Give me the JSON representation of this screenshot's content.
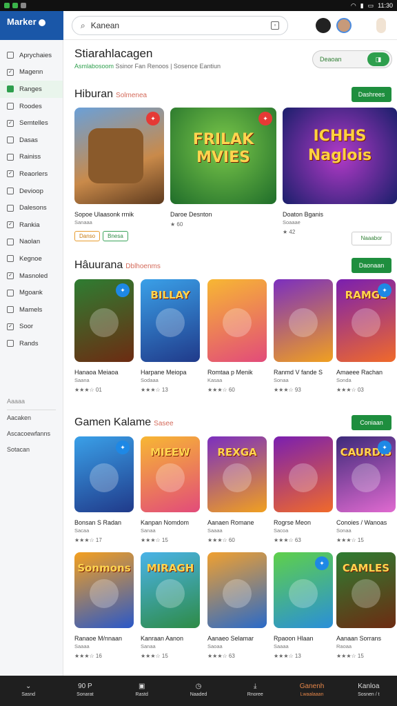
{
  "status": {
    "time": "11:30"
  },
  "app": {
    "logo": "Marker",
    "logo_sub": ""
  },
  "search": {
    "value": "Kanean"
  },
  "sidebar": {
    "items": [
      {
        "label": "Aprychaies"
      },
      {
        "label": "Magenn"
      },
      {
        "label": "Ranges",
        "active": true
      },
      {
        "label": "Roodes"
      },
      {
        "label": "Semtelles"
      },
      {
        "label": "Dasas"
      },
      {
        "label": "Rainiss"
      },
      {
        "label": "Reaorlers"
      },
      {
        "label": "Devioop"
      },
      {
        "label": "Dalesons"
      },
      {
        "label": "Rankia"
      },
      {
        "label": "Naolan"
      },
      {
        "label": "Kegnoe"
      },
      {
        "label": "Masnoled"
      },
      {
        "label": "Mgoank"
      },
      {
        "label": "Mamels"
      },
      {
        "label": "Soor"
      },
      {
        "label": "Rands"
      }
    ],
    "footer_head": "Aaaaa",
    "footer": [
      "Aacaken",
      "Ascacoewfanns",
      "Sotacan"
    ]
  },
  "header": {
    "title": "Stiarahlacagen",
    "subtitle_green": "Asmlabosoom",
    "subtitle_rest": "Ssinor Fan Renoos | Sosence Eantiun",
    "pill_label": "Deaoan"
  },
  "sections": [
    {
      "title": "Hiburan",
      "aux": "Solmenea",
      "button": "Dashrees",
      "cards": [
        {
          "name": "Sopoe Ulaasonk rrnik",
          "meta": "Sanaaa",
          "tags": [
            "Danso",
            "Bnesa"
          ]
        },
        {
          "name": "Daroe Desnton",
          "meta": "",
          "rating": "★ 60",
          "art_title": "FRILAK MVIES"
        },
        {
          "name": "Doaton Bganis",
          "meta": "Soaaae",
          "rating": "★ 42",
          "art_title": "ICHHS Naglois",
          "button": "Naaabor"
        }
      ]
    },
    {
      "title": "Hâuurana",
      "aux": "Dblhoenms",
      "button": "Daonaan",
      "cards": [
        {
          "name": "Hanaoa Meiaoa",
          "meta": "Saana",
          "rating": "★★★☆ 01"
        },
        {
          "name": "Harpane Meiopa",
          "meta": "Sodaaa",
          "rating": "★★★☆ 13",
          "art_title": "BILLAY"
        },
        {
          "name": "Romtaa p Menik",
          "meta": "Kasaa",
          "rating": "★★★☆ 60"
        },
        {
          "name": "Ranmd V fande S",
          "meta": "Sonaa",
          "rating": "★★★☆ 93"
        },
        {
          "name": "Amaeee Rachan",
          "meta": "Sonda",
          "rating": "★★★☆ 03",
          "art_title": "RAMGE"
        }
      ]
    },
    {
      "title": "Gamen Kalame",
      "aux": "Sasee",
      "button": "Coniaan",
      "cards": [
        {
          "name": "Bonsan S Radan",
          "meta": "Sacaa",
          "rating": "★★★☆ 17"
        },
        {
          "name": "Kanpan Nomdom",
          "meta": "Sanaa",
          "rating": "★★★☆ 15",
          "art_title": "MIEEW"
        },
        {
          "name": "Aanaen Romane",
          "meta": "Saaaa",
          "rating": "★★★☆ 60",
          "art_title": "REXGA"
        },
        {
          "name": "Rogrse Meon",
          "meta": "Sacoa",
          "rating": "★★★☆ 63"
        },
        {
          "name": "Conoies / Wanoas",
          "meta": "Sonaa",
          "rating": "★★★☆ 15",
          "art_title": "CAURDIS"
        },
        {
          "name": "Ranaoe M/nnaan",
          "meta": "Saaaa",
          "rating": "★★★☆ 16",
          "art_title": "Sonmons"
        },
        {
          "name": "Kanraan Aanon",
          "meta": "Sanaa",
          "rating": "★★★☆ 15",
          "art_title": "MIRAGH"
        },
        {
          "name": "Aanaeo Selamar",
          "meta": "Saoaa",
          "rating": "★★★☆ 63"
        },
        {
          "name": "Rpaoon Hlaan",
          "meta": "Saaaa",
          "rating": "★★★☆ 13"
        },
        {
          "name": "Aanaan Sorrans",
          "meta": "Raoaa",
          "rating": "★★★☆ 15",
          "art_title": "CAMLES"
        }
      ]
    }
  ],
  "bottom_nav": [
    {
      "label": "Sasnd",
      "icon": "chevron-down-icon"
    },
    {
      "label": "Sonarat",
      "top": "90 P",
      "icon": "home-icon"
    },
    {
      "label": "Rastd",
      "icon": "image-icon"
    },
    {
      "label": "Naaded",
      "icon": "clock-icon"
    },
    {
      "label": "Rnoree",
      "icon": "download-icon"
    },
    {
      "label": "Lwaalaaan",
      "top": "Ganenh",
      "icon": "apps-icon",
      "active": true
    },
    {
      "label": "Sosnen / t",
      "top": "Kanloa",
      "icon": "account-icon"
    }
  ],
  "colors": {
    "accent": "#1e8e3e",
    "logo_bg": "#1a57a8",
    "star": "#f4b400"
  }
}
